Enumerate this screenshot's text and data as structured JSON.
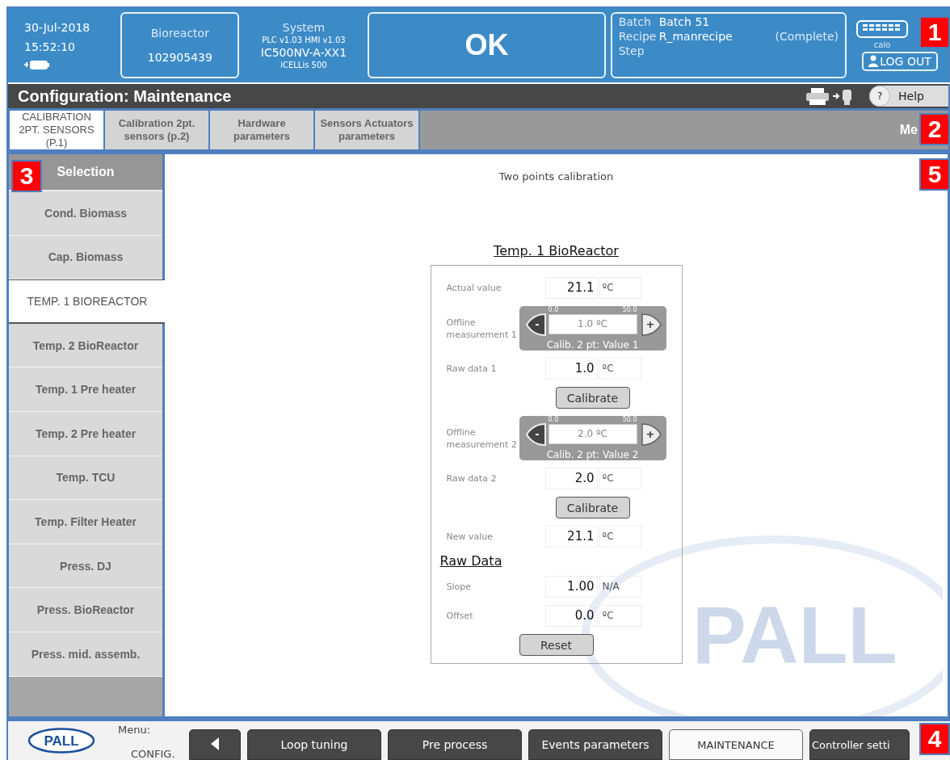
{
  "header": {
    "date": "30-Jul-2018",
    "time": "15:52:10",
    "bioreactor": {
      "label": "Bioreactor",
      "value": "102905439"
    },
    "system": {
      "label": "System",
      "versions": "PLC v1.03 HMI v1.03",
      "model": "IC500NV-A-XX1",
      "product": "iCELLis 500"
    },
    "status": "OK",
    "batch": [
      {
        "label": "Batch",
        "value": "Batch 51"
      },
      {
        "label": "Recipe",
        "value": "R_manrecipe",
        "note": "(Complete)"
      },
      {
        "label": "Step"
      }
    ],
    "user": "caio",
    "logout": "LOG OUT"
  },
  "title_bar": {
    "title": "Configuration: Maintenance",
    "help_mark": "?",
    "help": "Help"
  },
  "tabs": [
    {
      "label": "CALIBRATION 2PT. SENSORS (P.1)",
      "selected": true
    },
    {
      "label": "Calibration 2pt. sensors (p.2)",
      "selected": false
    },
    {
      "label": "Hardware parameters",
      "selected": false
    },
    {
      "label": "Sensors Actuators parameters",
      "selected": false
    }
  ],
  "tabs_right_label": "Me",
  "sidebar": {
    "title": "Selection",
    "items": [
      {
        "label": "Cond. Biomass",
        "selected": false
      },
      {
        "label": "Cap. Biomass",
        "selected": false
      },
      {
        "label": "TEMP. 1 BIOREACTOR",
        "selected": true
      },
      {
        "label": "Temp. 2 BioReactor",
        "selected": false
      },
      {
        "label": "Temp. 1 Pre heater",
        "selected": false
      },
      {
        "label": "Temp. 2 Pre heater",
        "selected": false
      },
      {
        "label": "Temp. TCU",
        "selected": false
      },
      {
        "label": "Temp. Filter Heater",
        "selected": false
      },
      {
        "label": "Press. DJ",
        "selected": false
      },
      {
        "label": "Press. BioReactor",
        "selected": false
      },
      {
        "label": "Press. mid. assemb.",
        "selected": false
      }
    ]
  },
  "content": {
    "caption": "Two points calibration",
    "panel_title": "Temp. 1 BioReactor",
    "watermark": "PALL",
    "rows": [
      {
        "kind": "value",
        "label": "Actual value",
        "value": "21.1",
        "unit": "ºC"
      },
      {
        "kind": "spinner",
        "label": "Offline measurement 1",
        "min": "0.0",
        "max": "50.0",
        "value": "1.0 ºC",
        "caption": "Calib. 2 pt: Value 1",
        "minus": "-",
        "plus": "+"
      },
      {
        "kind": "value",
        "label": "Raw data 1",
        "value": "1.0",
        "unit": "ºC"
      },
      {
        "kind": "button",
        "label": "Calibrate"
      },
      {
        "kind": "spinner",
        "label": "Offline measurement 2",
        "min": "0.0",
        "max": "50.0",
        "value": "2.0 ºC",
        "caption": "Calib. 2 pt: Value 2",
        "minus": "-",
        "plus": "+"
      },
      {
        "kind": "value",
        "label": "Raw data 2",
        "value": "2.0",
        "unit": "ºC"
      },
      {
        "kind": "button",
        "label": "Calibrate"
      },
      {
        "kind": "value",
        "label": "New value",
        "value": "21.1",
        "unit": "ºC"
      },
      {
        "kind": "heading",
        "label": "Raw Data"
      },
      {
        "kind": "value",
        "label": "Slope",
        "value": "1.00",
        "unit": "N/A"
      },
      {
        "kind": "value",
        "label": "Offset",
        "value": "0.0",
        "unit": "ºC"
      },
      {
        "kind": "button",
        "label": "Reset"
      }
    ]
  },
  "bottom_bar": {
    "logo": "PALL",
    "menu_label": "Menu:",
    "menu_value": "CONFIG.",
    "buttons": [
      {
        "kind": "back",
        "selected": false
      },
      {
        "kind": "text",
        "label": "Loop tuning",
        "selected": false
      },
      {
        "kind": "text",
        "label": "Pre process",
        "selected": false
      },
      {
        "kind": "text",
        "label": "Events parameters",
        "selected": false
      },
      {
        "kind": "text",
        "label": "MAINTENANCE",
        "selected": true
      },
      {
        "kind": "text",
        "label": "Controller setti",
        "selected": false
      }
    ]
  },
  "callouts": [
    "1",
    "2",
    "3",
    "5",
    "4"
  ]
}
